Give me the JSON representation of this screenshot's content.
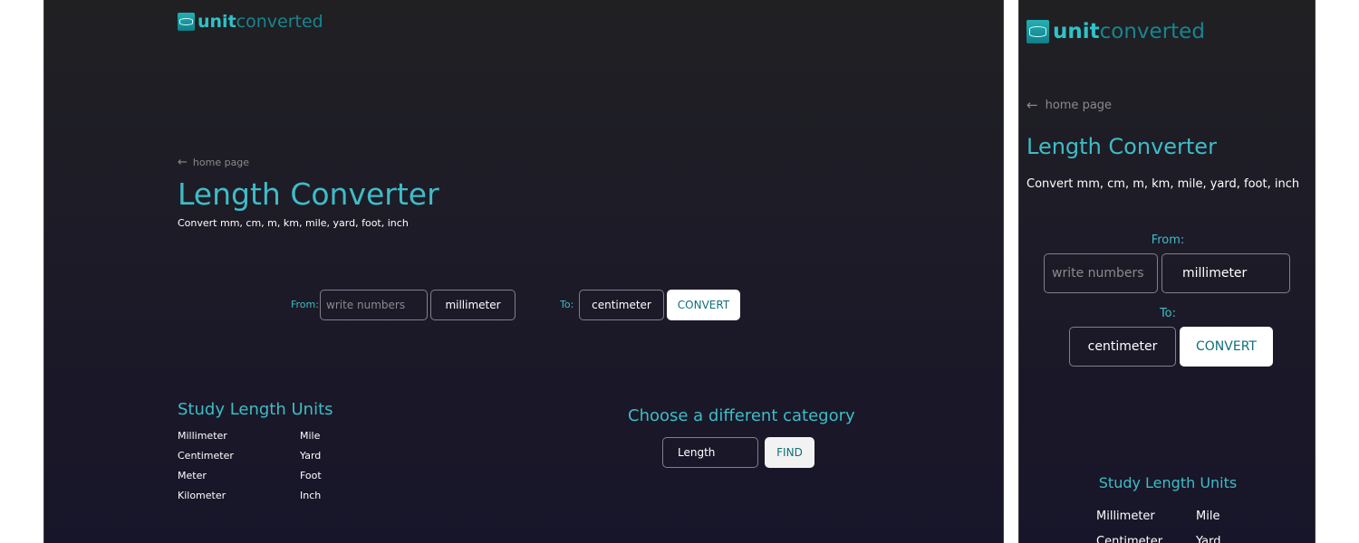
{
  "logo": {
    "part1": "unit",
    "part2": "converted"
  },
  "nav": {
    "back_label": "home page",
    "back_icon": "arrow-left-icon"
  },
  "page": {
    "title": "Length Converter",
    "subtitle": "Convert mm, cm, m, km, mile, yard, foot, inch"
  },
  "converter": {
    "from_label": "From:",
    "to_label": "To:",
    "input_placeholder": "write numbers",
    "from_unit": "millimeter",
    "to_unit": "centimeter",
    "convert_label": "CONVERT"
  },
  "study": {
    "title": "Study Length Units",
    "units": [
      "Millimeter",
      "Centimeter",
      "Meter",
      "Kilometer",
      "Mile",
      "Yard",
      "Foot",
      "Inch"
    ]
  },
  "category": {
    "title": "Choose a different category",
    "selected": "Length",
    "find_label": "FIND"
  },
  "colors": {
    "accent": "#3fbcc6",
    "brand_dark": "#18858f",
    "background": "#1d1b27",
    "button_bg": "#ffffff"
  }
}
